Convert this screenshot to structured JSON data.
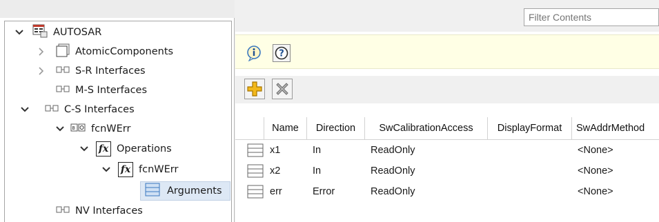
{
  "tree": {
    "items": [
      {
        "label": "AUTOSAR",
        "expanded": "open",
        "icon": "autosar-root-icon"
      },
      {
        "label": "AtomicComponents",
        "expanded": "closed",
        "icon": "component-icon"
      },
      {
        "label": "S-R Interfaces",
        "expanded": "closed",
        "icon": "interface-icon"
      },
      {
        "label": "M-S Interfaces",
        "expanded": "none",
        "icon": "interface-icon"
      },
      {
        "label": "C-S Interfaces",
        "expanded": "open",
        "icon": "interface-icon"
      },
      {
        "label": "fcnWErr",
        "expanded": "open",
        "icon": "cs-interface-icon"
      },
      {
        "label": "Operations",
        "expanded": "open",
        "icon": "fx-icon"
      },
      {
        "label": "fcnWErr",
        "expanded": "open",
        "icon": "fx-icon"
      },
      {
        "label": "Arguments",
        "expanded": "none",
        "icon": "list-icon",
        "selected": true
      },
      {
        "label": "NV Interfaces",
        "expanded": "none",
        "icon": "interface-icon"
      }
    ]
  },
  "filter": {
    "placeholder": "Filter Contents"
  },
  "info_bar": {
    "info_icon": "info-icon",
    "help_icon": "help-icon",
    "help_glyph": "?"
  },
  "toolbar": {
    "add_icon": "add-icon",
    "delete_icon": "delete-icon"
  },
  "table": {
    "columns": [
      "Name",
      "Direction",
      "SwCalibrationAccess",
      "DisplayFormat",
      "SwAddrMethod"
    ],
    "rows": [
      {
        "name": "x1",
        "direction": "In",
        "access": "ReadOnly",
        "display": "",
        "addr": "<None>"
      },
      {
        "name": "x2",
        "direction": "In",
        "access": "ReadOnly",
        "display": "",
        "addr": "<None>"
      },
      {
        "name": "err",
        "direction": "Error",
        "access": "ReadOnly",
        "display": "",
        "addr": "<None>"
      }
    ]
  },
  "colors": {
    "info_bar_bg": "#ffffe5",
    "selection_bg": "#dde8f5",
    "accent_blue": "#3a78c0",
    "add_yellow": "#f2b81c"
  }
}
